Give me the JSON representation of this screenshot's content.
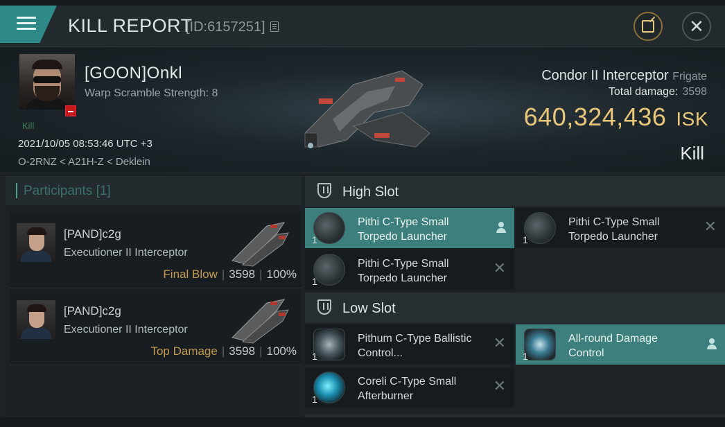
{
  "header": {
    "title": "KILL REPORT",
    "kill_id": "[ID:6157251]"
  },
  "victim": {
    "name": "[GOON]Onkl",
    "detail": "Warp Scramble Strength: 8",
    "tag": "Kill",
    "datetime": "2021/10/05 08:53:46 UTC +3",
    "location": "O-2RNZ < A21H-Z < Deklein"
  },
  "ship": {
    "name": "Condor II Interceptor",
    "class": "Frigate",
    "total_damage_label": "Total damage:",
    "total_damage": "3598",
    "value": "640,324,436",
    "currency": "ISK",
    "result": "Kill"
  },
  "participants": {
    "header": "Participants",
    "count": "[1]",
    "list": [
      {
        "name": "[PAND]c2g",
        "ship": "Executioner II Interceptor",
        "role": "Final Blow",
        "damage": "3598",
        "percent": "100%"
      },
      {
        "name": "[PAND]c2g",
        "ship": "Executioner II Interceptor",
        "role": "Top Damage",
        "damage": "3598",
        "percent": "100%"
      }
    ]
  },
  "fitting": {
    "high_slot": {
      "label": "High Slot",
      "items": [
        {
          "qty": "1",
          "name": "Pithi C-Type Small Torpedo Launcher",
          "state": "selected"
        },
        {
          "qty": "1",
          "name": "Pithi C-Type Small Torpedo Launcher",
          "state": "destroyed"
        },
        {
          "qty": "1",
          "name": "Pithi C-Type Small Torpedo Launcher",
          "state": "destroyed"
        }
      ]
    },
    "low_slot": {
      "label": "Low Slot",
      "items": [
        {
          "qty": "1",
          "name": "Pithum C-Type Ballistic Control...",
          "state": "destroyed"
        },
        {
          "qty": "1",
          "name": "All-round Damage Control",
          "state": "selected"
        },
        {
          "qty": "1",
          "name": "Coreli C-Type Small Afterburner",
          "state": "destroyed"
        }
      ]
    }
  },
  "colors": {
    "accent": "#3c7f7c",
    "isk": "#e9c77a",
    "role": "#c49a52"
  }
}
